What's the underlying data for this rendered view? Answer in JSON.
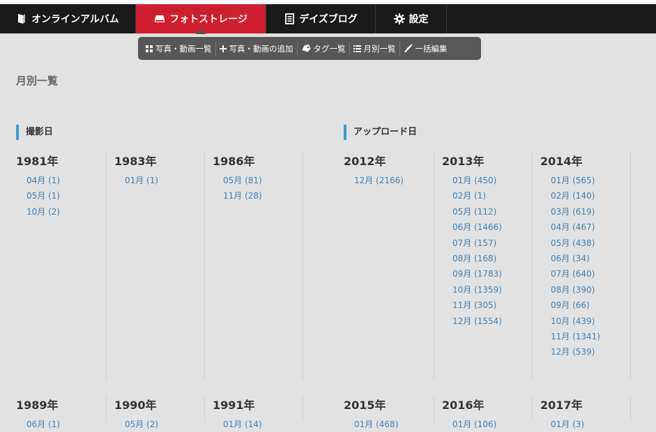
{
  "navbar": {
    "tabs": [
      {
        "label": "オンラインアルバム",
        "icon": "album-book-icon"
      },
      {
        "label": "フォトストレージ",
        "icon": "storage-drive-icon",
        "active": true
      },
      {
        "label": "デイズブログ",
        "icon": "blog-page-icon"
      },
      {
        "label": "設定",
        "icon": "gear-icon"
      }
    ]
  },
  "subnav": {
    "items": [
      {
        "label": "写真・動画一覧",
        "icon": "grid-icon"
      },
      {
        "label": "写真・動画の追加",
        "icon": "plus-icon"
      },
      {
        "label": "タグ一覧",
        "icon": "tag-icon"
      },
      {
        "label": "月別一覧",
        "icon": "list-icon"
      },
      {
        "label": "一括編集",
        "icon": "brush-icon"
      }
    ]
  },
  "page": {
    "title": "月別一覧"
  },
  "sections": {
    "shooting": {
      "label": "撮影日",
      "years": [
        {
          "year": "1981年",
          "months": [
            "04月 (1)",
            "05月 (1)",
            "10月 (2)"
          ]
        },
        {
          "year": "1983年",
          "months": [
            "01月 (1)"
          ]
        },
        {
          "year": "1986年",
          "months": [
            "05月 (81)",
            "11月 (28)"
          ]
        },
        {
          "year": "1989年",
          "months": [
            "06月 (1)"
          ]
        },
        {
          "year": "1990年",
          "months": [
            "05月 (2)"
          ]
        },
        {
          "year": "1991年",
          "months": [
            "01月 (14)"
          ]
        }
      ]
    },
    "upload": {
      "label": "アップロード日",
      "years": [
        {
          "year": "2012年",
          "months": [
            "12月 (2166)"
          ]
        },
        {
          "year": "2013年",
          "months": [
            "01月 (450)",
            "02月 (1)",
            "05月 (112)",
            "06月 (1466)",
            "07月 (157)",
            "08月 (168)",
            "09月 (1783)",
            "10月 (1359)",
            "11月 (305)",
            "12月 (1554)"
          ]
        },
        {
          "year": "2014年",
          "months": [
            "01月 (565)",
            "02月 (140)",
            "03月 (619)",
            "04月 (467)",
            "05月 (438)",
            "06月 (34)",
            "07月 (640)",
            "08月 (390)",
            "09月 (66)",
            "10月 (439)",
            "11月 (1341)",
            "12月 (539)"
          ]
        },
        {
          "year": "2015年",
          "months": [
            "01月 (468)"
          ]
        },
        {
          "year": "2016年",
          "months": [
            "01月 (106)"
          ]
        },
        {
          "year": "2017年",
          "months": [
            "01月 (3)"
          ]
        }
      ]
    }
  },
  "colors": {
    "active_tab": "#cf1f2e",
    "accent_bar": "#3a9ad9",
    "link": "#3f7fb3",
    "navbar": "#1a1a1a"
  }
}
